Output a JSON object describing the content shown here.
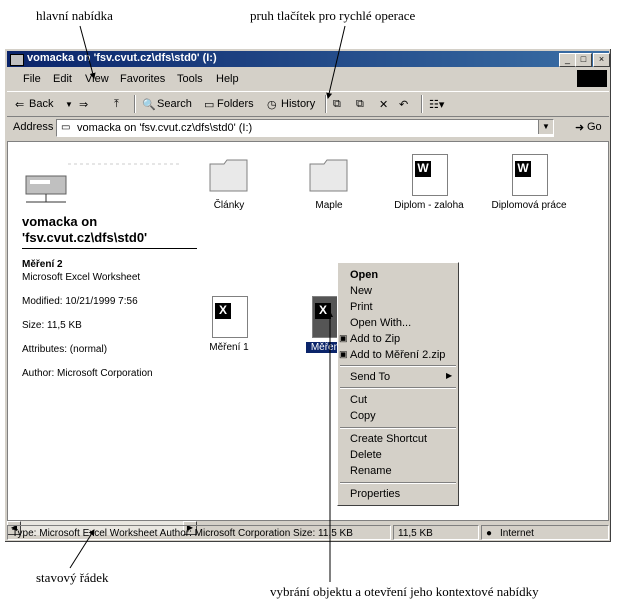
{
  "annotations": {
    "main_menu": "hlavní nabídka",
    "toolbar": "pruh tlačítek pro rychlé operace",
    "status": "stavový řádek",
    "context": "vybrání objektu a otevření jeho kontextové nabídky"
  },
  "window": {
    "title": "vomacka on 'fsv.cvut.cz\\dfs\\std0' (I:)"
  },
  "menu": [
    "File",
    "Edit",
    "View",
    "Favorites",
    "Tools",
    "Help"
  ],
  "toolbar": {
    "back": "Back",
    "search": "Search",
    "folders": "Folders",
    "history": "History"
  },
  "address": {
    "label": "Address",
    "value": "vomacka on 'fsv.cvut.cz\\dfs\\std0' (I:)",
    "go": "Go"
  },
  "panel": {
    "title": "vomacka on 'fsv.cvut.cz\\dfs\\std0'",
    "name": "Měření 2",
    "type": "Microsoft Excel Worksheet",
    "modified": "Modified: 10/21/1999 7:56",
    "size": "Size: 11,5 KB",
    "attributes": "Attributes: (normal)",
    "author": "Author: Microsoft Corporation"
  },
  "files": [
    "Články",
    "Maple",
    "Diplom - zaloha",
    "Diplomová práce",
    "Měření 1",
    "Měřen"
  ],
  "context_menu": [
    "Open",
    "New",
    "Print",
    "Open With...",
    "Add to Zip",
    "Add to Měření 2.zip",
    "Send To",
    "Cut",
    "Copy",
    "Create Shortcut",
    "Delete",
    "Rename",
    "Properties"
  ],
  "status": {
    "main": "Type: Microsoft Excel Worksheet Author: Microsoft Corporation Size: 11,5 KB",
    "size": "11,5 KB",
    "zone": "Internet"
  }
}
